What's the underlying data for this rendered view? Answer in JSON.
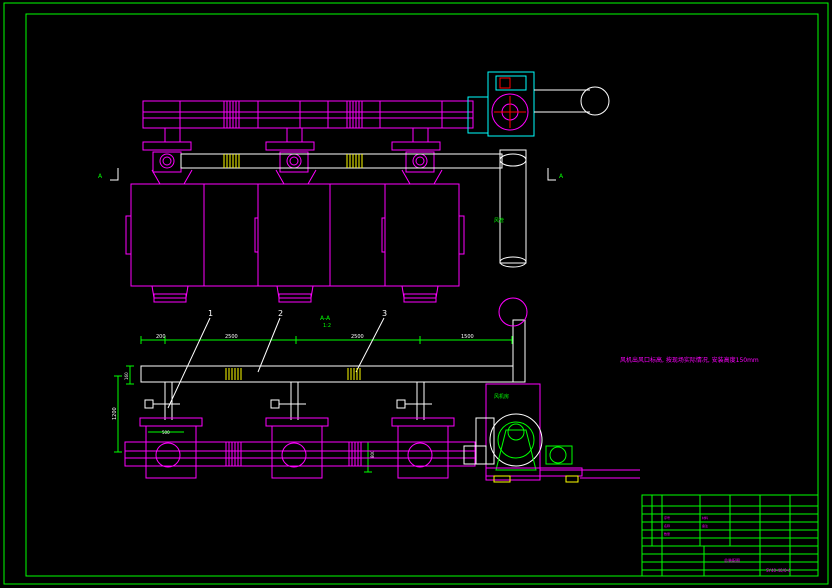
{
  "drawing": {
    "section_marker_left": "A",
    "section_marker_right": "A",
    "section_title_top": "A-A",
    "section_title_bottom": "1:2",
    "duct_note": "风管",
    "fan_room_label": "风机房",
    "part_labels": [
      "1",
      "2",
      "3"
    ],
    "dims": {
      "d200": "200",
      "d2500_left": "2500",
      "d2500_right": "2500",
      "d1500": "1500",
      "d_vert_small": "160",
      "d_vert_large": "1200",
      "d_mid_small": "500",
      "d_right_small": "800"
    },
    "note": "风机出风口标高, 按现场实际情况, 安装高度150mm"
  },
  "title_block": {
    "drawing_name": "SY40-40/0-4",
    "subtitle": "总装配图",
    "rows": [
      "序号",
      "名称",
      "数量",
      "材料",
      "备注"
    ]
  },
  "colors": {
    "frame": "#00ff00",
    "magenta": "#ff00ff",
    "yellow": "#ffff00",
    "white": "#ffffff",
    "cyan": "#00ffff",
    "green": "#00ff00"
  }
}
